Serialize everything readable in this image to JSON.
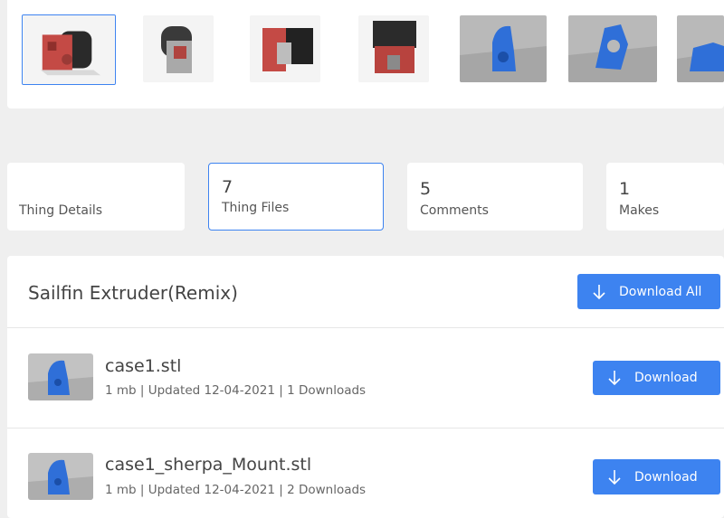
{
  "colors": {
    "accent": "#3d83f0",
    "background": "#efefef",
    "card": "#ffffff"
  },
  "gallery": {
    "thumbnails": [
      {
        "icon": "extruder-red-render-icon",
        "selected": true
      },
      {
        "icon": "extruder-side-render-icon",
        "selected": false
      },
      {
        "icon": "extruder-red-front-icon",
        "selected": false
      },
      {
        "icon": "extruder-black-red-icon",
        "selected": false
      },
      {
        "icon": "blue-part-render-icon",
        "selected": false
      },
      {
        "icon": "blue-mount-render-icon",
        "selected": false
      },
      {
        "icon": "blue-part-partial-icon",
        "selected": false
      }
    ]
  },
  "tabs": [
    {
      "count": "",
      "label": "Thing Details",
      "active": false
    },
    {
      "count": "7",
      "label": "Thing Files",
      "active": true
    },
    {
      "count": "5",
      "label": "Comments",
      "active": false
    },
    {
      "count": "1",
      "label": "Makes",
      "active": false
    }
  ],
  "files": {
    "title": "Sailfin Extruder(Remix)",
    "download_all_label": "Download All",
    "items": [
      {
        "name": "case1.stl",
        "meta": "1 mb | Updated 12-04-2021 | 1 Downloads",
        "download_label": "Download"
      },
      {
        "name": "case1_sherpa_Mount.stl",
        "meta": "1 mb | Updated 12-04-2021 | 2 Downloads",
        "download_label": "Download"
      }
    ]
  }
}
